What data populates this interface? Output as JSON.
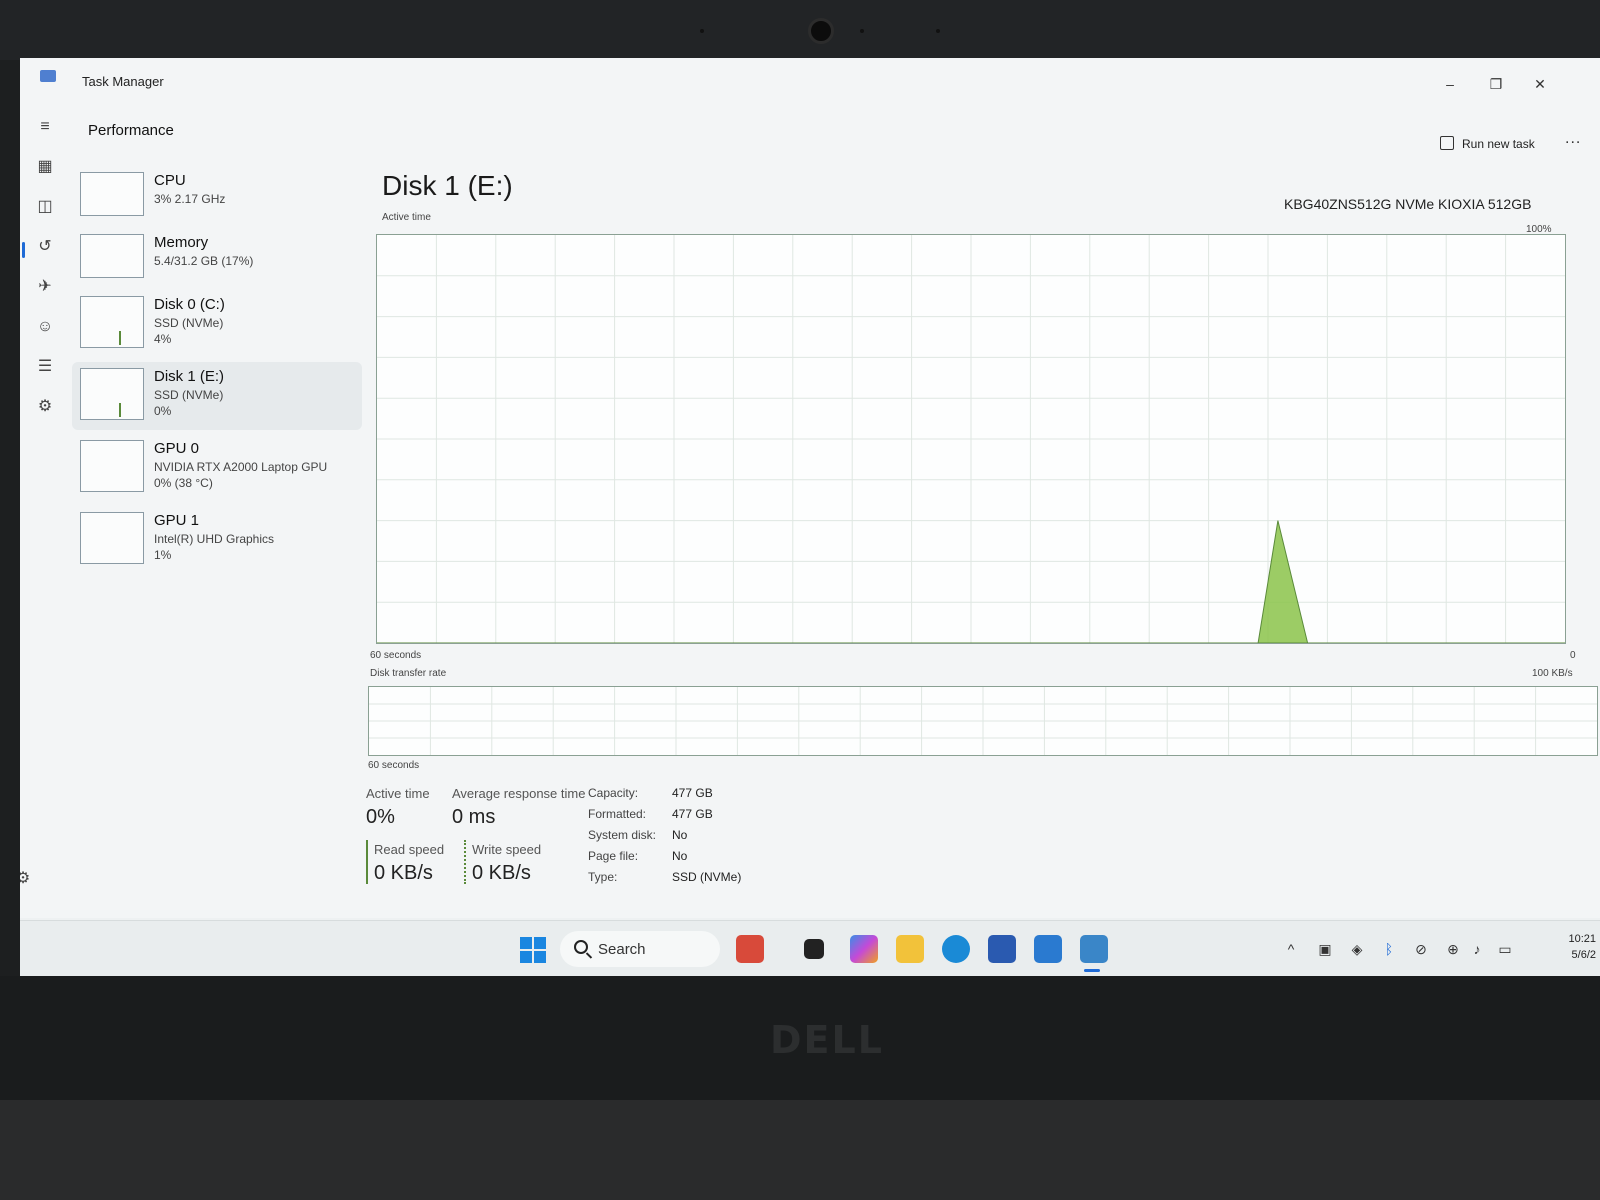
{
  "window": {
    "title": "Task Manager",
    "minimize": "–",
    "maximize": "❐",
    "close": "✕"
  },
  "header": {
    "section": "Performance",
    "run_new_task": "Run new task",
    "more": "..."
  },
  "sidebar": {
    "items": [
      {
        "name": "CPU",
        "sub": "3% 2.17 GHz",
        "sub2": ""
      },
      {
        "name": "Memory",
        "sub": "5.4/31.2 GB (17%)",
        "sub2": ""
      },
      {
        "name": "Disk 0 (C:)",
        "sub": "SSD (NVMe)",
        "sub2": "4%"
      },
      {
        "name": "Disk 1 (E:)",
        "sub": "SSD (NVMe)",
        "sub2": "0%"
      },
      {
        "name": "GPU 0",
        "sub": "NVIDIA RTX A2000 Laptop GPU",
        "sub2": "0% (38 °C)"
      },
      {
        "name": "GPU 1",
        "sub": "Intel(R) UHD Graphics",
        "sub2": "1%"
      }
    ],
    "selected": "Disk 1 (E:)"
  },
  "main": {
    "title": "Disk 1 (E:)",
    "model": "KBG40ZNS512G NVMe KIOXIA 512GB",
    "active_chart": {
      "label": "Active time",
      "max_label": "100%",
      "time_label": "60 seconds",
      "zero_label": "0"
    },
    "transfer_chart": {
      "label": "Disk transfer rate",
      "max_label": "100 KB/s",
      "time_label": "60 seconds"
    },
    "stats": {
      "active_time_label": "Active time",
      "active_time": "0%",
      "avg_response_label": "Average response time",
      "avg_response": "0 ms",
      "read_speed_label": "Read speed",
      "read_speed": "0 KB/s",
      "write_speed_label": "Write speed",
      "write_speed": "0 KB/s"
    },
    "info": [
      {
        "label": "Capacity:",
        "value": "477 GB"
      },
      {
        "label": "Formatted:",
        "value": "477 GB"
      },
      {
        "label": "System disk:",
        "value": "No"
      },
      {
        "label": "Page file:",
        "value": "No"
      },
      {
        "label": "Type:",
        "value": "SSD (NVMe)"
      }
    ]
  },
  "chart_data": {
    "type": "area",
    "title": "Active time",
    "x_range": [
      60,
      0
    ],
    "ylim": [
      0,
      100
    ],
    "x": [
      60,
      17,
      15.5,
      14.5,
      13,
      0
    ],
    "values": [
      0,
      0,
      0,
      30,
      0,
      0
    ],
    "color": "#8bc34a"
  },
  "taskbar": {
    "search": "Search",
    "time": "10:21",
    "date": "5/6/2"
  },
  "brand": "DELL",
  "colors": {
    "accent": "#1e6ad6",
    "disk_green": "#8bc34a",
    "disk_border": "#5a8a3a"
  }
}
